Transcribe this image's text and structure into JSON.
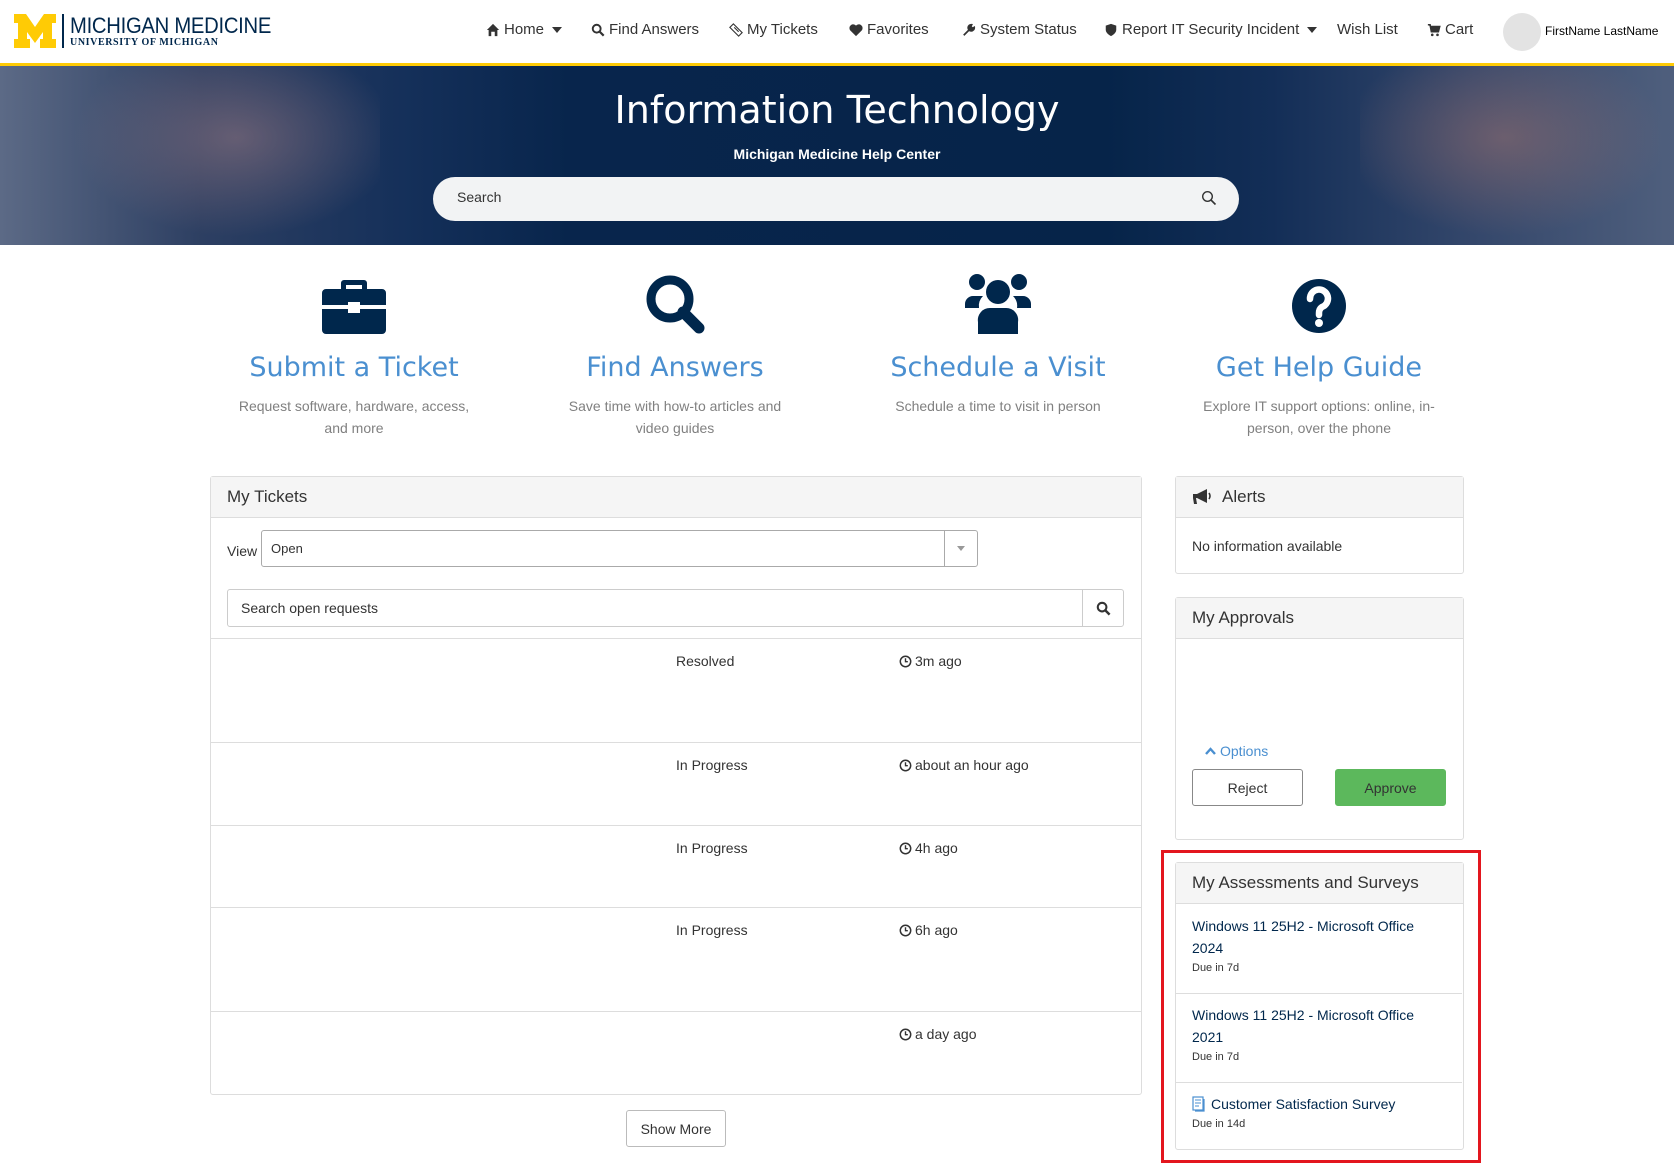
{
  "header": {
    "logo_main": "MICHIGAN MEDICINE",
    "logo_sub": "UNIVERSITY OF MICHIGAN",
    "nav": {
      "home": "Home",
      "find_answers": "Find Answers",
      "my_tickets": "My Tickets",
      "favorites": "Favorites",
      "system_status": "System Status",
      "report_incident": "Report IT Security Incident",
      "wish_list": "Wish List",
      "cart": "Cart"
    },
    "user_name": "FirstName LastName"
  },
  "hero": {
    "title": "Information Technology",
    "subtitle": "Michigan Medicine Help Center",
    "search_placeholder": "Search"
  },
  "tiles": [
    {
      "icon": "briefcase-icon",
      "title": "Submit a Ticket",
      "desc": "Request software, hardware, access, and more"
    },
    {
      "icon": "search-icon",
      "title": "Find Answers",
      "desc": "Save time with how-to articles and video guides"
    },
    {
      "icon": "users-icon",
      "title": "Schedule a Visit",
      "desc": "Schedule a time to visit in person"
    },
    {
      "icon": "question-circle-icon",
      "title": "Get Help Guide",
      "desc": "Explore IT support options: online, in-person, over the phone"
    }
  ],
  "my_tickets": {
    "title": "My Tickets",
    "view_label": "View",
    "view_value": "Open",
    "search_placeholder": "Search open requests",
    "rows": [
      {
        "status": "Resolved",
        "time": "3m ago"
      },
      {
        "status": "In Progress",
        "time": "about an hour ago"
      },
      {
        "status": "In Progress",
        "time": "4h ago"
      },
      {
        "status": "In Progress",
        "time": "6h ago"
      },
      {
        "status": "",
        "time": "a day ago"
      }
    ],
    "show_more": "Show More"
  },
  "alerts": {
    "title": "Alerts",
    "text": "No information available"
  },
  "approvals": {
    "title": "My Approvals",
    "options": "Options",
    "reject": "Reject",
    "approve": "Approve"
  },
  "surveys": {
    "title": "My Assessments and Surveys",
    "items": [
      {
        "title": "Windows 11 25H2 - Microsoft Office 2024",
        "due": "Due in 7d"
      },
      {
        "title": "Windows 11 25H2 - Microsoft Office 2021",
        "due": "Due in 7d"
      },
      {
        "title": "Customer Satisfaction Survey",
        "due": "Due in 14d",
        "icon": "survey-icon"
      }
    ]
  },
  "colors": {
    "brand_navy": "#00274c",
    "brand_maize": "#ffcb05",
    "link_blue": "#4a8fd0",
    "approve_green": "#5cb85c",
    "highlight_red": "#e3161e"
  }
}
